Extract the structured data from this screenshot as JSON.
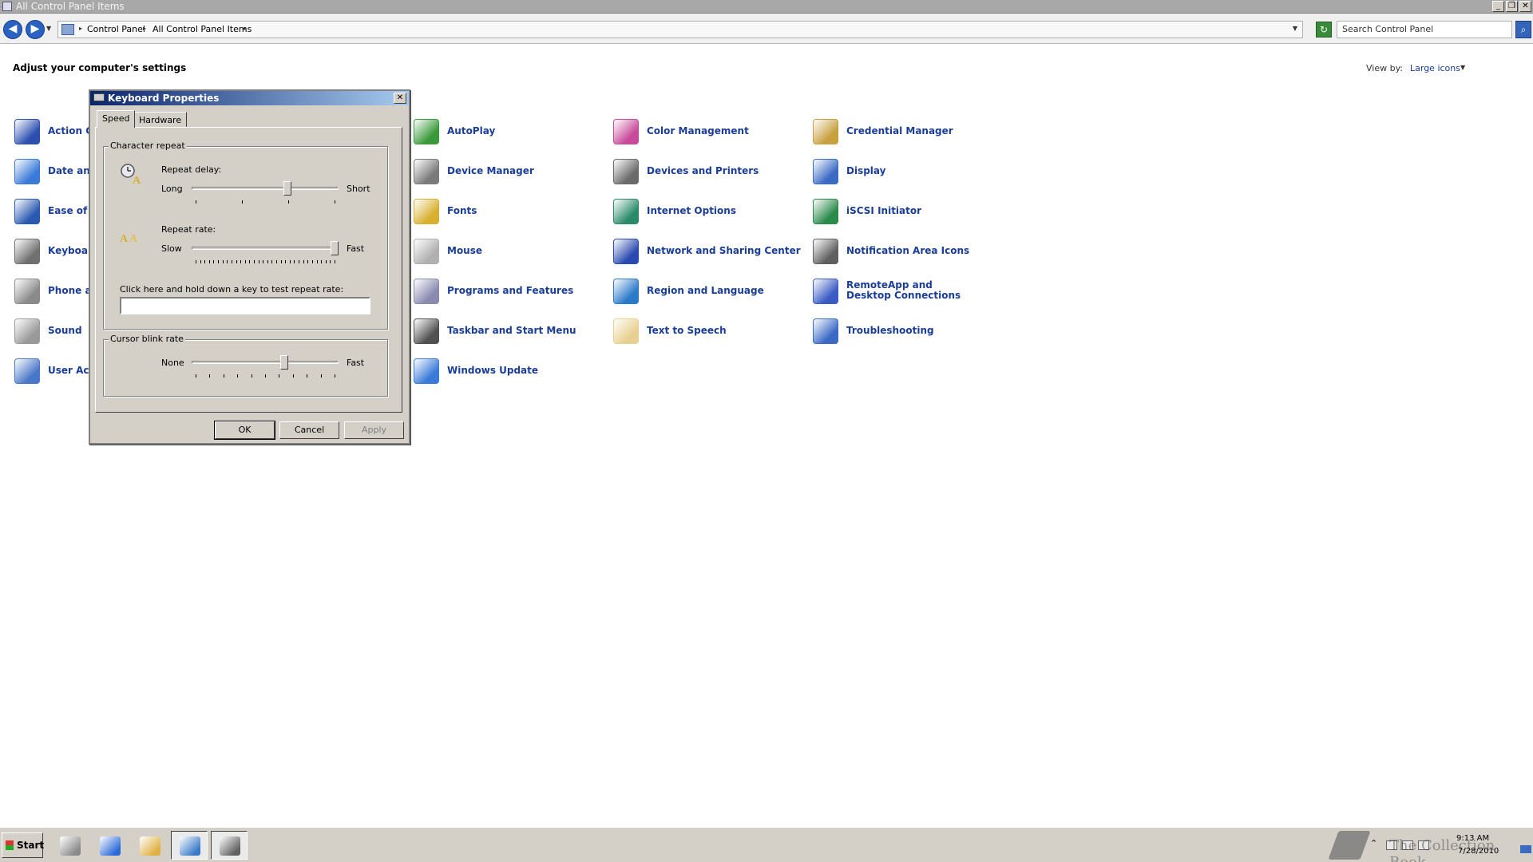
{
  "window": {
    "title": "All Control Panel Items",
    "buttons": [
      "_",
      "❐",
      "✕"
    ]
  },
  "address": {
    "back": "◀",
    "forward": "▶",
    "crumbs": [
      "Control Panel",
      "All Control Panel Items"
    ],
    "search_placeholder": "Search Control Panel"
  },
  "heading": "Adjust your computer's settings",
  "view_by": {
    "label": "View by:",
    "value": "Large icons"
  },
  "items": [
    {
      "label": "Action Center",
      "icon": "flag-icon",
      "color": "#2c4fb0"
    },
    {
      "label": "Date and Time",
      "icon": "calendar-clock-icon",
      "color": "#3a7ad8"
    },
    {
      "label": "Ease of Access Center",
      "icon": "accessibility-icon",
      "color": "#2a5ab0"
    },
    {
      "label": "Keyboard",
      "icon": "keyboard-icon",
      "color": "#707070"
    },
    {
      "label": "Phone and Modem",
      "icon": "phone-icon",
      "color": "#8a8a8a"
    },
    {
      "label": "Sound",
      "icon": "speaker-icon",
      "color": "#9a9a9a"
    },
    {
      "label": "User Accounts",
      "icon": "users-icon",
      "color": "#4a78c8"
    },
    {
      "label": "AutoPlay",
      "icon": "autoplay-icon",
      "color": "#3a9a3a"
    },
    {
      "label": "Device Manager",
      "icon": "device-manager-icon",
      "color": "#7a7a7a"
    },
    {
      "label": "Fonts",
      "icon": "fonts-icon",
      "color": "#d8b030"
    },
    {
      "label": "Mouse",
      "icon": "mouse-icon",
      "color": "#b0b0b0"
    },
    {
      "label": "Programs and Features",
      "icon": "programs-icon",
      "color": "#8a8ab0"
    },
    {
      "label": "Taskbar and Start Menu",
      "icon": "taskbar-icon",
      "color": "#505050"
    },
    {
      "label": "Windows Update",
      "icon": "windows-update-icon",
      "color": "#3a7ad8"
    },
    {
      "label": "Color Management",
      "icon": "color-management-icon",
      "color": "#c84a9a"
    },
    {
      "label": "Devices and Printers",
      "icon": "printer-icon",
      "color": "#6a6a6a"
    },
    {
      "label": "Internet Options",
      "icon": "globe-icon",
      "color": "#2a8a6a"
    },
    {
      "label": "Network and Sharing Center",
      "icon": "network-icon",
      "color": "#2a4ab0"
    },
    {
      "label": "Region and Language",
      "icon": "globe-clock-icon",
      "color": "#2a7ac8"
    },
    {
      "label": "Text to Speech",
      "icon": "speech-bubble-icon",
      "color": "#e8d090"
    },
    {
      "label": "Credential Manager",
      "icon": "vault-icon",
      "color": "#c8a040"
    },
    {
      "label": "Display",
      "icon": "monitor-icon",
      "color": "#3a6ac4"
    },
    {
      "label": "iSCSI Initiator",
      "icon": "iscsi-globe-icon",
      "color": "#2a8a4a"
    },
    {
      "label": "Notification Area Icons",
      "icon": "notification-icon",
      "color": "#606060"
    },
    {
      "label": "RemoteApp and Desktop Connections",
      "icon": "remote-desktop-icon",
      "color": "#3a5ac4"
    },
    {
      "label": "Troubleshooting",
      "icon": "troubleshoot-icon",
      "color": "#3a6ac4"
    }
  ],
  "dialog": {
    "title": "Keyboard Properties",
    "close": "✕",
    "tabs": [
      "Speed",
      "Hardware"
    ],
    "group_repeat": "Character repeat",
    "repeat_delay": {
      "label": "Repeat delay:",
      "min": "Long",
      "max": "Short",
      "value": 0.66
    },
    "repeat_rate": {
      "label": "Repeat rate:",
      "min": "Slow",
      "max": "Fast",
      "value": 1.0
    },
    "test_label": "Click here and hold down a key to test repeat rate:",
    "test_value": "",
    "group_cursor": "Cursor blink rate",
    "cursor_blink": {
      "min": "None",
      "max": "Fast",
      "value": 0.64
    },
    "buttons": {
      "ok": "OK",
      "cancel": "Cancel",
      "apply": "Apply"
    }
  },
  "taskbar": {
    "start": "Start",
    "apps": [
      {
        "icon": "server-manager-icon",
        "color": "#8a8a8a",
        "active": false
      },
      {
        "icon": "powershell-icon",
        "color": "#2a6ad8",
        "active": false
      },
      {
        "icon": "explorer-icon",
        "color": "#e0b040",
        "active": false
      },
      {
        "icon": "control-panel-icon",
        "color": "#3a7ac8",
        "active": true
      },
      {
        "icon": "keyboard-icon",
        "color": "#606060",
        "active": true
      }
    ],
    "clock_time": "9:13 AM",
    "clock_date": "7/28/2010",
    "watermark": "The Collection Book"
  }
}
